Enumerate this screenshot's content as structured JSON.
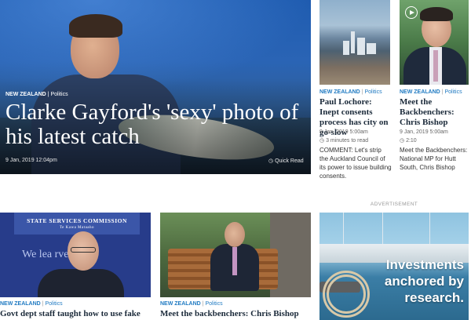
{
  "hero": {
    "section": "NEW ZEALAND",
    "category": "Politics",
    "title": "Clarke Gayford's 'sexy' photo of his latest catch",
    "date": "9 Jan, 2019 12:04pm",
    "quick_read": "Quick Read"
  },
  "cards": [
    {
      "section": "NEW ZEALAND",
      "category": "Politics",
      "title": "Paul Lochore: Inept consents process has city on go-slow",
      "date": "9 Jan, 2019 5:00am",
      "sub": "3 minutes to read",
      "summary": "COMMENT: Let's strip the Auckland Council of its power to issue building consents."
    },
    {
      "section": "NEW ZEALAND",
      "category": "Politics",
      "title": "Meet the Backbenchers: Chris Bishop",
      "date": "9 Jan, 2019 5:00am",
      "sub": "2:10",
      "summary": "Meet the Backbenchers: National MP for Hutt South, Chris Bishop"
    },
    {
      "section": "NEW ZEALAND",
      "category": "Politics",
      "title": "Govt dept staff taught how to use fake",
      "image_banner": "STATE SERVICES COMMISSION",
      "image_sub": "Te Kawa Mataaho",
      "image_slogan": "We lea      rve."
    },
    {
      "section": "NEW ZEALAND",
      "category": "Politics",
      "title": "Meet the backbenchers: Chris Bishop"
    }
  ],
  "ad": {
    "label": "ADVERTISEMENT",
    "text": "Investments anchored by research."
  },
  "icons": [
    "clock-icon",
    "play-icon"
  ]
}
